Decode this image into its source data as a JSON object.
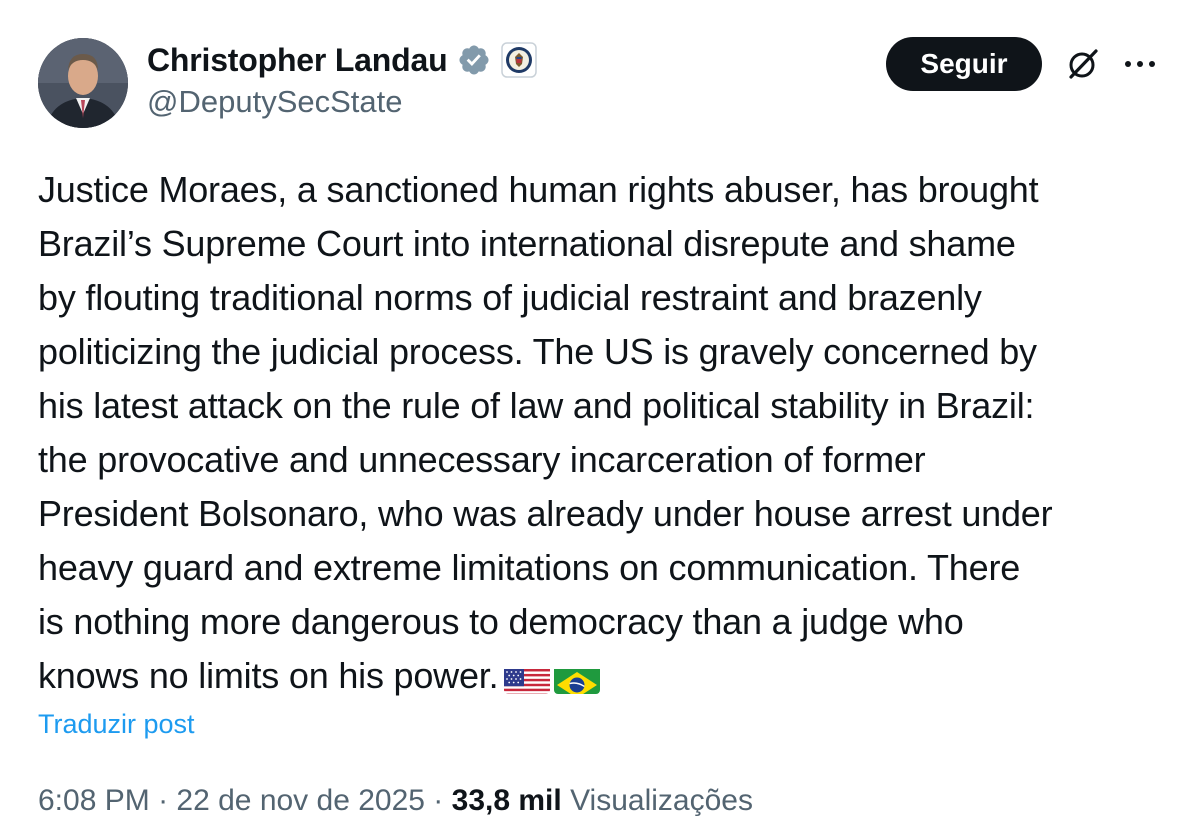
{
  "author": {
    "display_name": "Christopher Landau",
    "handle": "@DeputySecState",
    "verified_icon": "verified-badge-icon",
    "affiliation_icon": "state-department-seal-icon"
  },
  "actions": {
    "follow_label": "Seguir",
    "grok_icon": "grok-icon",
    "more_icon": "more-options-icon"
  },
  "tweet": {
    "lines": [
      "Justice Moraes, a sanctioned human rights abuser, has brought",
      "Brazil’s Supreme Court into international disrepute and shame",
      "by flouting traditional norms of judicial restraint and brazenly",
      "politicizing the judicial process. The US is gravely concerned by",
      "his latest attack on the rule of law and political stability in Brazil:",
      "the provocative and unnecessary incarceration of former",
      "President Bolsonaro, who was already under house arrest under",
      "heavy guard and extreme limitations on communication. There",
      "is nothing more dangerous to democracy than a judge who",
      "knows no limits on his power."
    ],
    "emoji": [
      "us-flag-icon",
      "brazil-flag-icon"
    ]
  },
  "translate_label": "Traduzir post",
  "meta": {
    "time": "6:08 PM",
    "separator": " · ",
    "date": "22 de nov de 2025",
    "views_count": "33,8 mil",
    "views_label": "Visualizações"
  },
  "colors": {
    "text": "#0f1419",
    "secondary": "#536471",
    "link": "#1d9bf0",
    "verified": "#829aab"
  }
}
